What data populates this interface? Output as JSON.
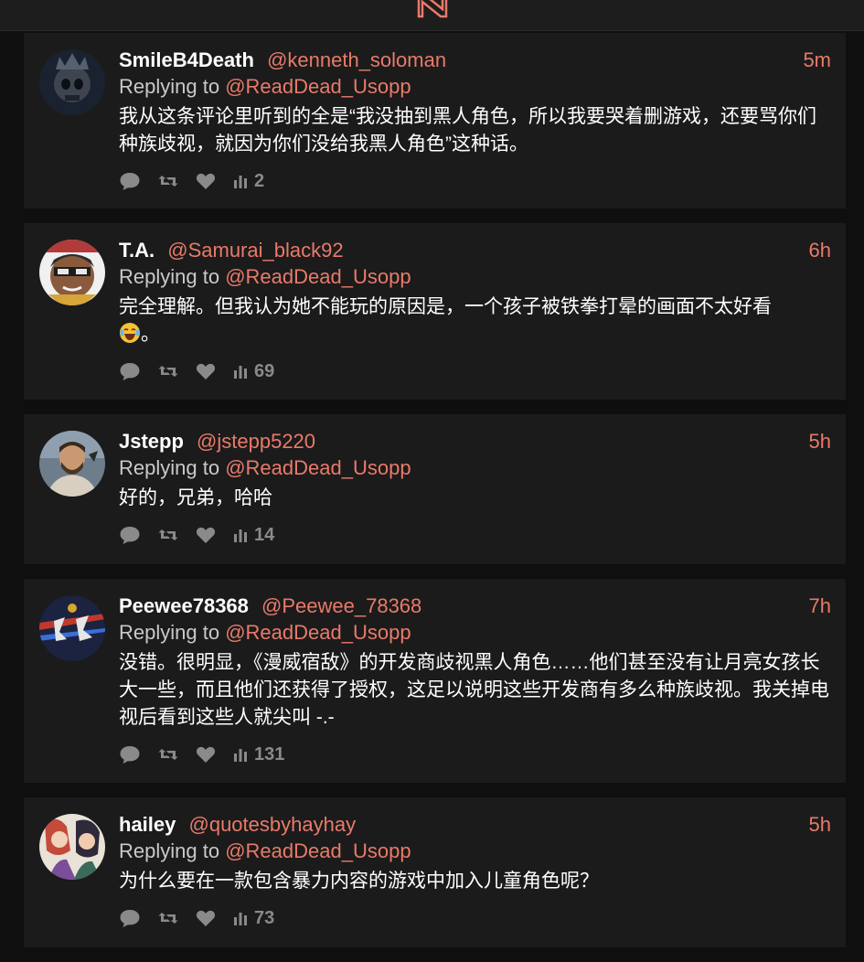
{
  "colors": {
    "background": "#0f0f0f",
    "card": "#1b1b1b",
    "accent": "#e97a6a",
    "muted": "#8a8a8a"
  },
  "header": {
    "logo_icon": "brand-logo-icon"
  },
  "replies": [
    {
      "name": "SmileB4Death",
      "handle": "@kenneth_soloman",
      "time": "5m",
      "replying_prefix": "Replying to",
      "replying_to": "@ReadDead_Usopp",
      "text": "我从这条评论里听到的全是“我没抽到黑人角色，所以我要哭着删游戏，还要骂你们种族歧视，就因为你们没给我黑人角色”这种话。",
      "views": "2",
      "avatar_icon": "skull-crown-avatar"
    },
    {
      "name": "T.A.",
      "handle": "@Samurai_black92",
      "time": "6h",
      "replying_prefix": "Replying to",
      "replying_to": "@ReadDead_Usopp",
      "text": "完全理解。但我认为她不能玩的原因是，一个孩子被铁拳打晕的画面不太好看",
      "text_tail": "。",
      "views": "69",
      "avatar_icon": "cartoon-face-avatar",
      "emoji": "laughing-tears-emoji"
    },
    {
      "name": "Jstepp",
      "handle": "@jstepp5220",
      "time": "5h",
      "replying_prefix": "Replying to",
      "replying_to": "@ReadDead_Usopp",
      "text": "好的，兄弟，哈哈",
      "views": "14",
      "avatar_icon": "bearded-man-avatar"
    },
    {
      "name": "Peewee78368",
      "handle": "@Peewee_78368",
      "time": "7h",
      "replying_prefix": "Replying to",
      "replying_to": "@ReadDead_Usopp",
      "text": "没错。很明显，《漫威宿敌》的开发商歧视黑人角色……他们甚至没有让月亮女孩长大一些，而且他们还获得了授权，这足以说明这些开发商有多么种族歧视。我关掉电视后看到这些人就尖叫 -.-",
      "views": "131",
      "avatar_icon": "gaming-logo-avatar"
    },
    {
      "name": "hailey",
      "handle": "@quotesbyhayhay",
      "time": "5h",
      "replying_prefix": "Replying to",
      "replying_to": "@ReadDead_Usopp",
      "text": "为什么要在一款包含暴力内容的游戏中加入儿童角色呢？",
      "views": "73",
      "avatar_icon": "anime-characters-avatar"
    }
  ]
}
